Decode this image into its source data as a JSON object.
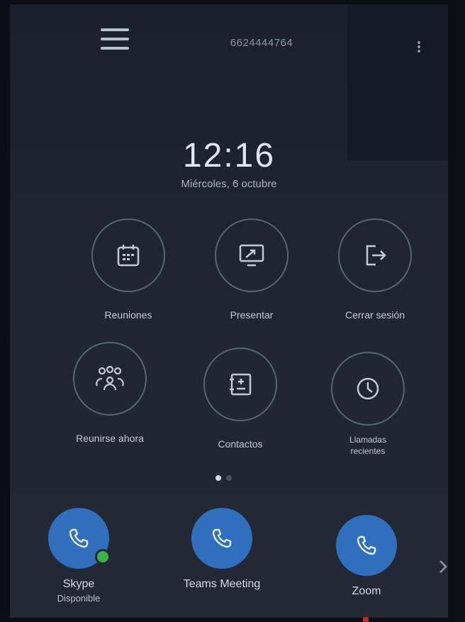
{
  "header": {
    "menu_icon": "hamburger-menu-icon",
    "phone_number": "6624444764",
    "more_icon": "more-vertical-icon"
  },
  "clock": {
    "time": "12:16",
    "date": "Miércoles, 6 octubre"
  },
  "apps": [
    {
      "label": "Reuniones",
      "icon": "calendar-icon"
    },
    {
      "label": "Presentar",
      "icon": "screen-share-icon"
    },
    {
      "label": "Cerrar sesión",
      "icon": "sign-out-icon"
    },
    {
      "label": "Reunirse ahora",
      "icon": "people-group-icon"
    },
    {
      "label": "Contactos",
      "icon": "contact-book-icon"
    },
    {
      "label": "Llamadas recientes",
      "icon": "clock-icon"
    }
  ],
  "pager": {
    "pages": 2,
    "current": 1
  },
  "dock": [
    {
      "label": "Skype",
      "sublabel": "Disponible",
      "icon": "phone-icon",
      "status_color": "#3cb34a"
    },
    {
      "label": "Teams Meeting",
      "icon": "phone-icon"
    },
    {
      "label": "Zoom",
      "icon": "phone-icon"
    }
  ],
  "dock_next_icon": "chevron-right-icon",
  "colors": {
    "accent": "#2f6fbd",
    "background": "#1f2531",
    "status_available": "#3cb34a"
  }
}
